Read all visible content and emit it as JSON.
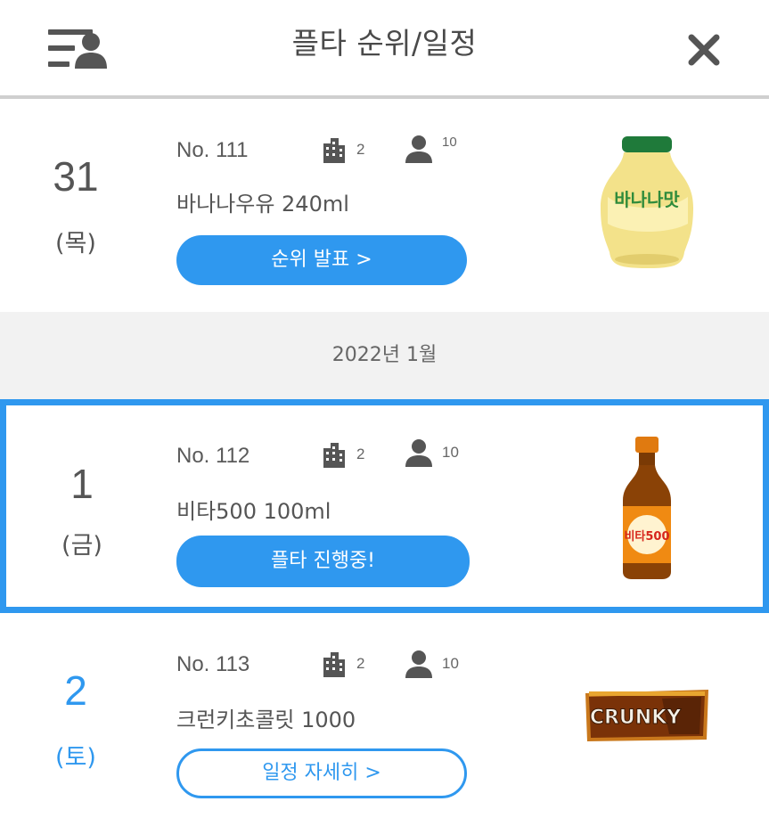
{
  "header": {
    "title": "플타 순위/일정",
    "menu_icon": "user-list-icon",
    "close_icon": "close-icon"
  },
  "colors": {
    "accent": "#2f98ef",
    "divider": "#cfcfcf",
    "month_bar_bg": "#f2f2f2"
  },
  "month_label": "2022년 1월",
  "events": [
    {
      "day": "31",
      "weekday": "(목)",
      "no": "No. 111",
      "buildings": "2",
      "people": "10",
      "product": "바나나우유 240ml",
      "button": "순위 발표 >",
      "image": "banana-milk-image"
    },
    {
      "day": "1",
      "weekday": "(금)",
      "no": "No. 112",
      "buildings": "2",
      "people": "10",
      "product": "비타500 100ml",
      "button": "플타 진행중!",
      "image": "vita500-image"
    },
    {
      "day": "2",
      "weekday": "(토)",
      "no": "No. 113",
      "buildings": "2",
      "people": "10",
      "product": "크런키초콜릿 1000",
      "button": "일정 자세히 >",
      "image": "crunky-chocolate-image"
    }
  ],
  "product_art": {
    "banana_label": "바나나맛",
    "vita_label": "비타500",
    "crunky_label": "CRUNKY"
  }
}
